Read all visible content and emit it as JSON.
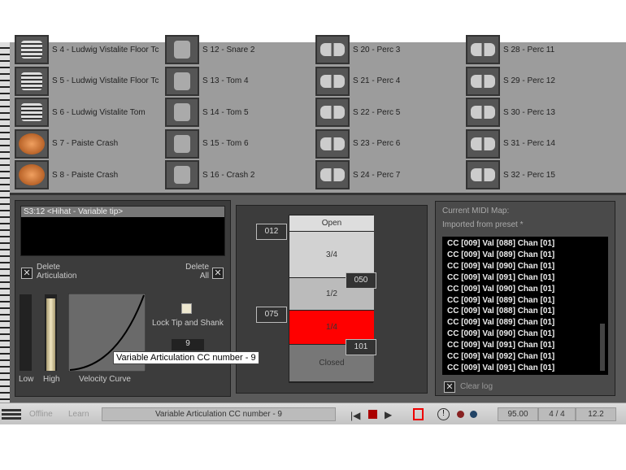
{
  "slots": [
    [
      "S 4 - Ludwig Vistalite Floor Tc",
      "S 12 - Snare 2",
      "S 20 - Perc 3",
      "S 28 - Perc 11"
    ],
    [
      "S 5 - Ludwig Vistalite Floor Tc",
      "S 13 - Tom 4",
      "S 21 - Perc 4",
      "S 29 - Perc 12"
    ],
    [
      "S 6 - Ludwig Vistalite Tom",
      "S 14 - Tom 5",
      "S 22 - Perc 5",
      "S 30 - Perc 13"
    ],
    [
      "S 7 - Paiste Crash",
      "S 15 - Tom 6",
      "S 23 - Perc 6",
      "S 31 - Perc 14"
    ],
    [
      "S 8 - Paiste Crash",
      "S 16 - Crash 2",
      "S 24 - Perc 7",
      "S 32 - Perc 15"
    ]
  ],
  "articulation": {
    "selected": "S3:12 <Hihat - Variable tip>",
    "delete_articulation": "Delete Articulation",
    "delete_all": "Delete All",
    "low": "Low",
    "high": "High",
    "velocity_curve": "Velocity Curve",
    "lock_tip": "Lock Tip and Shank",
    "cc_value": "9",
    "tooltip": "Variable Articulation CC number - 9",
    "high_level": 0.95
  },
  "zones": {
    "labels": [
      "Open",
      "3/4",
      "1/2",
      "1/4",
      "Closed"
    ],
    "thresholds": [
      "012",
      "050",
      "075",
      "101"
    ],
    "active": "1/4",
    "active_color": "#ff0000"
  },
  "midi": {
    "title": "Current MIDI Map:",
    "subtitle": "Imported from preset *",
    "log": [
      "CC [009] Val [088] Chan [01]",
      "CC [009] Val [089] Chan [01]",
      "CC [009] Val [090] Chan [01]",
      "CC [009] Val [091] Chan [01]",
      "CC [009] Val [090] Chan [01]",
      "CC [009] Val [089] Chan [01]",
      "CC [009] Val [088] Chan [01]",
      "CC [009] Val [089] Chan [01]",
      "CC [009] Val [090] Chan [01]",
      "CC [009] Val [091] Chan [01]",
      "CC [009] Val [092] Chan [01]",
      "CC [009] Val [091] Chan [01]"
    ],
    "clear": "Clear log"
  },
  "status": {
    "offline": "Offline",
    "learn": "Learn",
    "message": "Variable Articulation CC number - 9",
    "tempo": "95.00",
    "signature": "4 / 4",
    "position": "12.2"
  }
}
